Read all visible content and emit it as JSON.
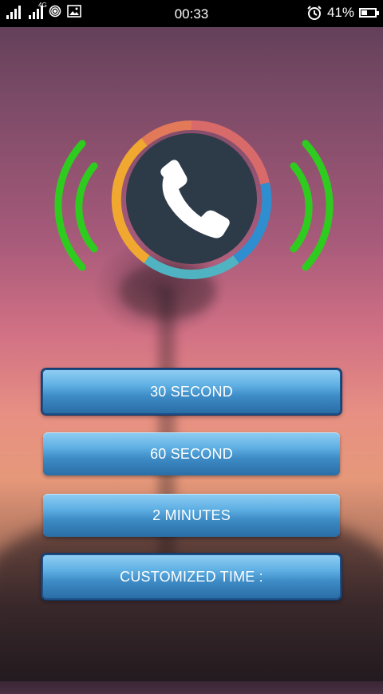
{
  "status_bar": {
    "network_type": "4G",
    "time": "00:33",
    "battery_percent": "41%",
    "icons": [
      "signal-icon",
      "signal-4g-icon",
      "hotspot-icon",
      "image-icon",
      "alarm-icon",
      "battery-icon"
    ]
  },
  "call_graphic": {
    "phone_icon": "phone-icon",
    "ring_colors": [
      "#e27a5a",
      "#d86a6a",
      "#2e8ed0",
      "#4fb3c2",
      "#f0a830"
    ],
    "wave_color": "#2ecc1f",
    "center_color": "#2d3a48"
  },
  "buttons": [
    {
      "label": "30 SECOND",
      "selected": true
    },
    {
      "label": "60 SECOND",
      "selected": false
    },
    {
      "label": "2 MINUTES",
      "selected": false
    },
    {
      "label": "CUSTOMIZED TIME :",
      "selected": true
    }
  ]
}
